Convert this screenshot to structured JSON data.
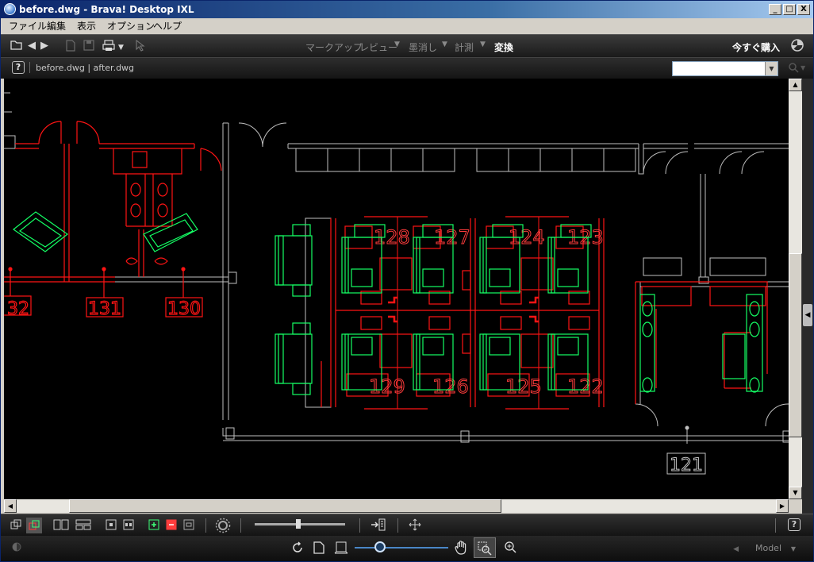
{
  "window": {
    "title": "before.dwg - Brava! Desktop IXL"
  },
  "caption_buttons": [
    "_",
    "□",
    "X"
  ],
  "menubar": [
    "ファイル",
    "編集",
    "表示",
    "オプション",
    "ヘルプ"
  ],
  "toolbar": {
    "modes": [
      "マークアップ",
      "レビュー",
      "墨消し",
      "計測",
      "変換"
    ],
    "active_mode": "変換",
    "buy_label": "今すぐ購入"
  },
  "tabs": {
    "help_label": "?",
    "file_list": "before.dwg | after.dwg"
  },
  "search": {
    "value": ""
  },
  "drawing": {
    "room_labels": [
      "32",
      "131",
      "130",
      "121"
    ],
    "cubicle_labels": [
      "128",
      "127",
      "124",
      "123",
      "129",
      "126",
      "125",
      "122"
    ],
    "colors": {
      "walls": "#c0c0c0",
      "before": "#ff1414",
      "after": "#14ff64"
    }
  },
  "bottom": {
    "zoom_level": 0.27,
    "model_label": "Model"
  }
}
